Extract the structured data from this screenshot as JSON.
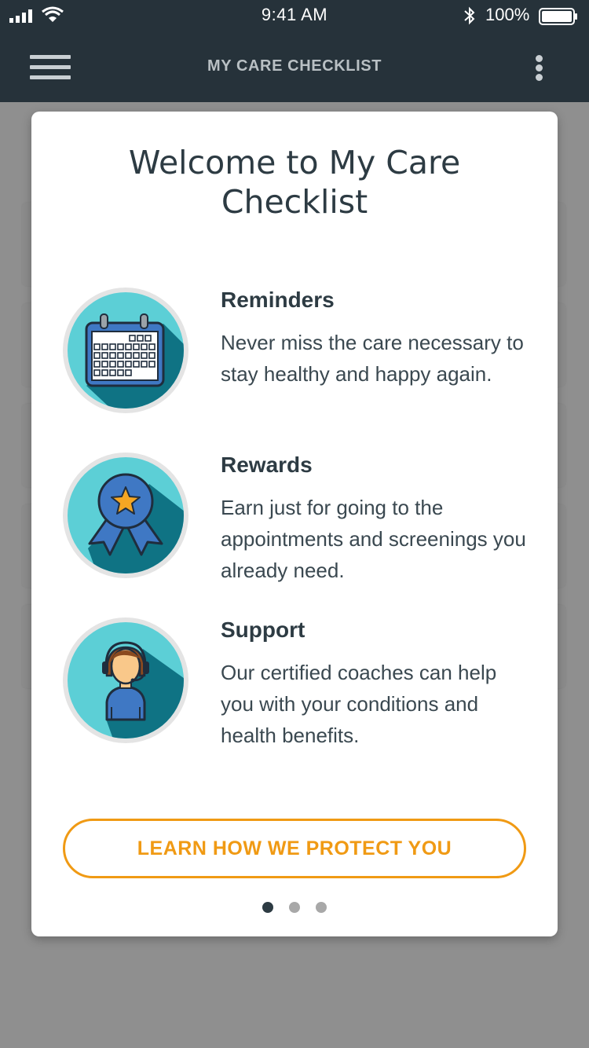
{
  "status_bar": {
    "time": "9:41 AM",
    "battery_percent": "100%",
    "battery_level": 1.0,
    "icons": [
      "signal-icon",
      "wifi-icon",
      "bluetooth-icon",
      "battery-icon"
    ]
  },
  "header": {
    "title": "MY CARE CHECKLIST",
    "menu_icon": "hamburger-menu-icon",
    "more_icon": "more-vertical-icon"
  },
  "modal": {
    "title": "Welcome to My Care Checklist",
    "features": [
      {
        "icon": "calendar-icon",
        "title": "Reminders",
        "description": "Never miss the care necessary to stay healthy and happy again."
      },
      {
        "icon": "award-ribbon-icon",
        "title": "Rewards",
        "description": "Earn just for going to the appointments and screenings you already need."
      },
      {
        "icon": "support-agent-icon",
        "title": "Support",
        "description": "Our certified coaches can help you with your conditions and health benefits."
      }
    ],
    "cta_label": "LEARN HOW WE PROTECT YOU",
    "pagination": {
      "total": 3,
      "active": 1
    }
  },
  "colors": {
    "header_bg": "#26323a",
    "accent_orange": "#f09a14",
    "icon_teal": "#5ccfd6",
    "icon_shadow_teal": "#0f7384",
    "icon_blue": "#3f78c4",
    "text_dark": "#2d3b43"
  }
}
